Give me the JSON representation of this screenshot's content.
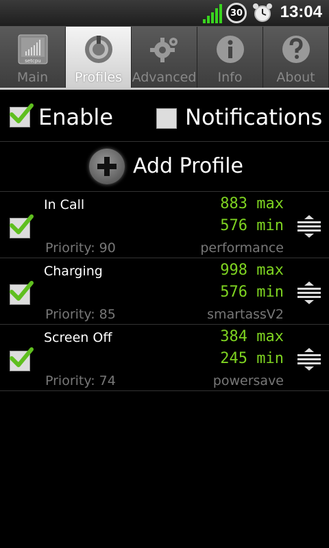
{
  "status": {
    "battery": "30",
    "time": "13:04"
  },
  "tabs": [
    {
      "label": "Main",
      "icon": "setcpu-icon",
      "active": false
    },
    {
      "label": "Profiles",
      "icon": "profiles-icon",
      "active": true
    },
    {
      "label": "Advanced",
      "icon": "gear-icon",
      "active": false
    },
    {
      "label": "Info",
      "icon": "info-icon",
      "active": false
    },
    {
      "label": "About",
      "icon": "question-icon",
      "active": false
    }
  ],
  "main_icon_text": "setcpu",
  "enable": {
    "label": "Enable",
    "checked": true
  },
  "notifications": {
    "label": "Notifications",
    "checked": false
  },
  "add_profile": {
    "label": "Add Profile"
  },
  "profiles": [
    {
      "name": "In Call",
      "max": "883 max",
      "min": "576 min",
      "priority": "Priority: 90",
      "governor": "performance",
      "checked": true
    },
    {
      "name": "Charging",
      "max": "998 max",
      "min": "576 min",
      "priority": "Priority: 85",
      "governor": "smartassV2",
      "checked": true
    },
    {
      "name": "Screen Off",
      "max": "384 max",
      "min": "245 min",
      "priority": "Priority: 74",
      "governor": "powersave",
      "checked": true
    }
  ],
  "colors": {
    "accent_green": "#7ed321",
    "check_green": "#5fbf1f"
  }
}
